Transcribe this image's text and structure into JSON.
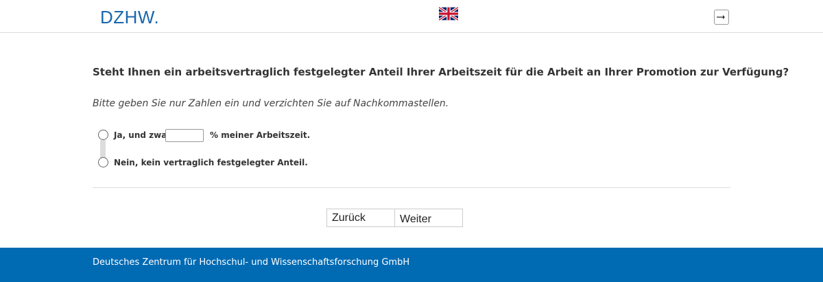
{
  "header": {
    "logo": "DZHW.",
    "language_flag_icon": "uk-flag-icon",
    "logout_icon": "logout-icon"
  },
  "question": {
    "title": "Steht Ihnen ein arbeitsvertraglich festgelegter Anteil Ihrer Arbeitszeit für die Arbeit an Ihrer Promotion zur Verfügung?",
    "hint": "Bitte geben Sie nur Zahlen ein und verzichten Sie auf Nachkommastellen.",
    "options": [
      {
        "prefix": "Ja, und zwar",
        "suffix": "% meiner Arbeitszeit.",
        "input_value": ""
      },
      {
        "label": "Nein, kein vertraglich festgelegter Anteil."
      }
    ]
  },
  "navigation": {
    "back_label": "Zurück",
    "next_label": "Weiter"
  },
  "footer": {
    "text": "Deutsches Zentrum für Hochschul- und Wissenschaftsforschung GmbH"
  },
  "colors": {
    "brand_blue": "#006ab3",
    "logo_blue": "#1a66ad"
  }
}
